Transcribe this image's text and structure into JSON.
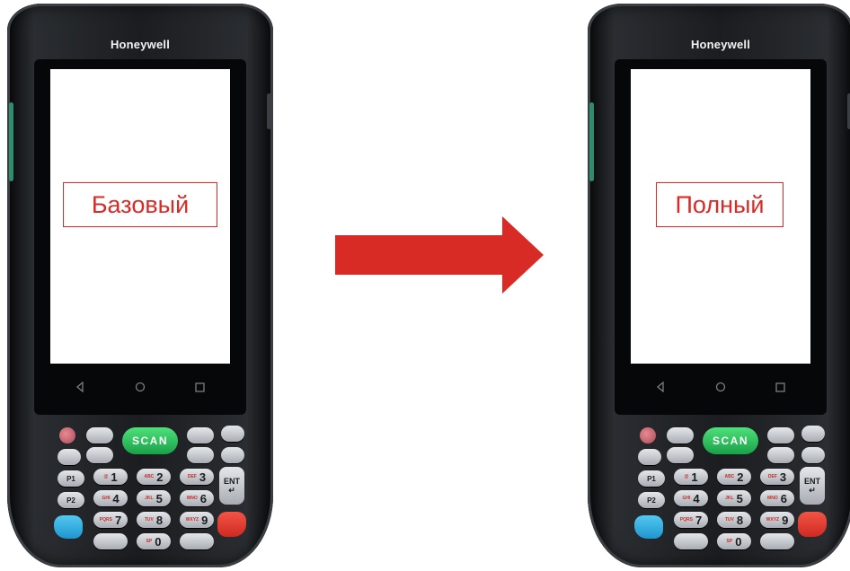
{
  "devices": [
    {
      "brand": "Honeywell",
      "screen_label": "Базовый",
      "scan_label": "SCAN",
      "enter_label": "ENT",
      "keys": {
        "p1": "P1",
        "p2": "P2",
        "n1": "1",
        "n2": "2",
        "n3": "3",
        "n4": "4",
        "n5": "5",
        "n6": "6",
        "n7": "7",
        "n8": "8",
        "n9": "9",
        "n0": "0"
      }
    },
    {
      "brand": "Honeywell",
      "screen_label": "Полный",
      "scan_label": "SCAN",
      "enter_label": "ENT",
      "keys": {
        "p1": "P1",
        "p2": "P2",
        "n1": "1",
        "n2": "2",
        "n3": "3",
        "n4": "4",
        "n5": "5",
        "n6": "6",
        "n7": "7",
        "n8": "8",
        "n9": "9",
        "n0": "0"
      }
    }
  ],
  "colors": {
    "accent": "#d92b25",
    "scan": "#22b04f",
    "device_body": "#1b1d20"
  },
  "icons": [
    "back-icon",
    "home-icon",
    "recent-apps-icon",
    "arrow-right-icon"
  ]
}
